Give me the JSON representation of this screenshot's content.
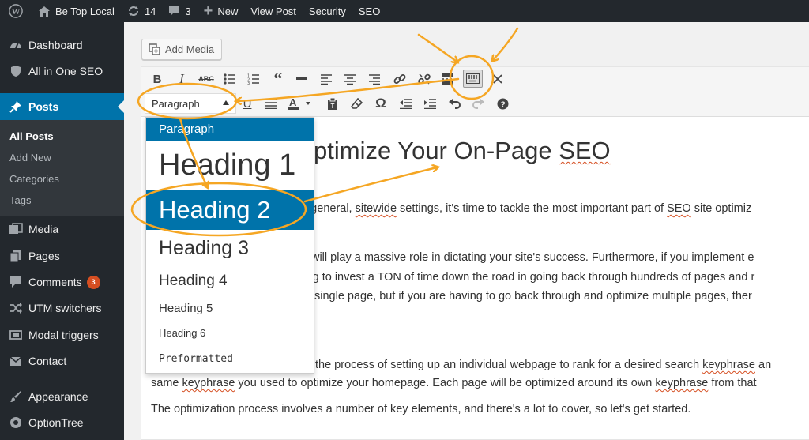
{
  "admin_bar": {
    "site_name": "Be Top Local",
    "updates_count": "14",
    "comments_count": "3",
    "new_label": "New",
    "view_post_label": "View Post",
    "security_label": "Security",
    "seo_label": "SEO"
  },
  "sidebar": {
    "dashboard": "Dashboard",
    "all_in_one_seo": "All in One SEO",
    "posts": "Posts",
    "submenu": {
      "all_posts": "All Posts",
      "add_new": "Add New",
      "categories": "Categories",
      "tags": "Tags"
    },
    "media": "Media",
    "pages": "Pages",
    "comments": "Comments",
    "comments_badge": "3",
    "utm_switchers": "UTM switchers",
    "modal_triggers": "Modal triggers",
    "contact": "Contact",
    "appearance": "Appearance",
    "optiontree": "OptionTree"
  },
  "editor": {
    "add_media_label": "Add Media",
    "format_select_value": "Paragraph",
    "toolbar_icons_row1": [
      "bold-icon",
      "italic-icon",
      "strikethrough-icon",
      "bulleted-list-icon",
      "numbered-list-icon",
      "blockquote-icon",
      "horizontal-line-icon",
      "align-left-icon",
      "align-center-icon",
      "align-right-icon",
      "insert-link-icon",
      "remove-link-icon",
      "read-more-icon",
      "toolbar-toggle-icon",
      "close-x-icon"
    ],
    "toolbar_icons_row2": [
      "underline-icon",
      "justify-icon",
      "text-color-icon",
      "paste-text-icon",
      "clear-formatting-icon",
      "special-character-icon",
      "outdent-icon",
      "indent-icon",
      "undo-icon",
      "redo-icon",
      "help-icon"
    ],
    "format_options": [
      "Paragraph",
      "Heading 1",
      "Heading 2",
      "Heading 3",
      "Heading 4",
      "Heading 5",
      "Heading 6",
      "Preformatted"
    ],
    "selected_option": "Heading 2",
    "title_visible": "ptimize Your On-Page ",
    "title_seo": "SEO",
    "paragraphs": {
      "p1_a": "the general, ",
      "p1_b": "sitewide",
      "p1_c": " settings, it's time to tackle the most important part of ",
      "p1_d": "SEO",
      "p1_e": " site optimiz",
      "p2_a": "EO will play a massive role in dictating your site's success. Furthermore, if you implement e",
      "p3_a": "aving to invest a TON of time down the road in going back through hundreds of pages and r",
      "p4_a": "or a single page, but if you are having to go back through and optimize multiple pages, ther",
      "p5_a": "the process of setting up an individual webpage to rank for a desired search ",
      "p5_b": "keyphrase",
      "p5_c": " an",
      "p6_a": "same ",
      "p6_b": "keyphrase",
      "p6_c": " you used to optimize your homepage. Each page will be optimized around its own ",
      "p6_d": "keyphrase",
      "p6_e": " from that",
      "p7": "The optimization process involves a number of key elements, and there's a lot to cover, so let's get started."
    }
  },
  "colors": {
    "admin_dark": "#23282d",
    "submenu_bg": "#32373c",
    "accent_blue": "#0073aa",
    "annotation_orange": "#f5a623",
    "badge_red": "#d54e21"
  }
}
